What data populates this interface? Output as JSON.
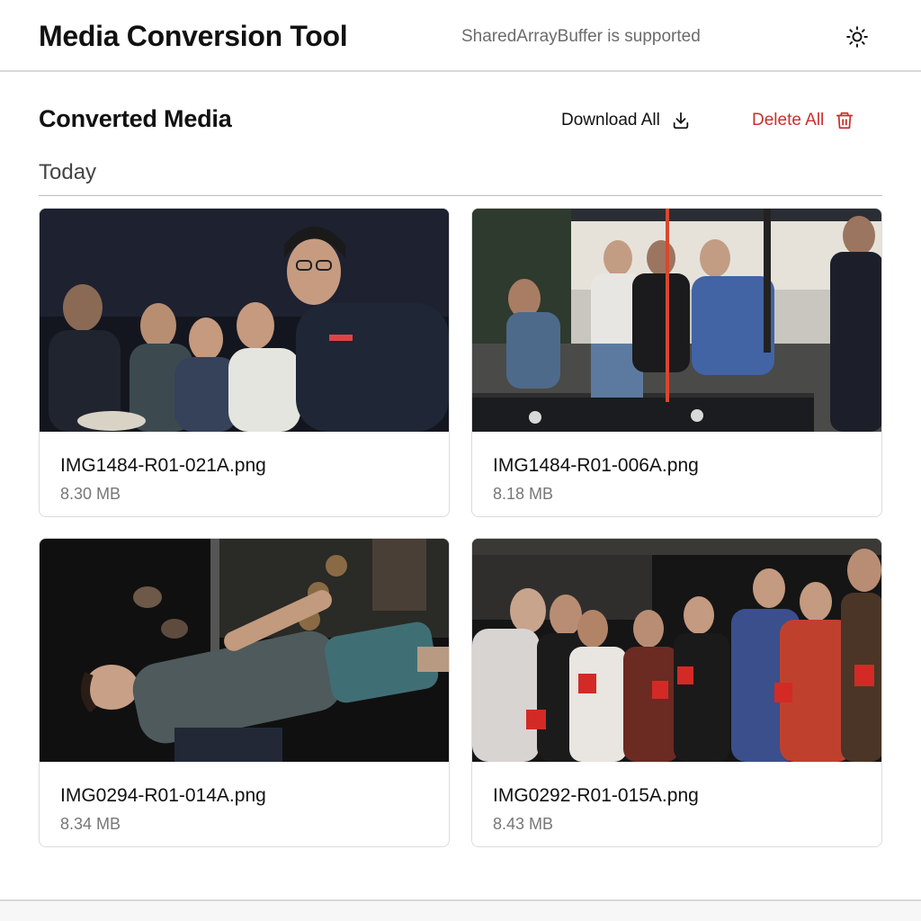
{
  "header": {
    "title": "Media Conversion Tool",
    "status": "SharedArrayBuffer is supported",
    "theme_icon": "sun-icon"
  },
  "section": {
    "title": "Converted Media",
    "download_all_label": "Download All",
    "download_icon": "download-icon",
    "delete_all_label": "Delete All",
    "delete_icon": "trash-icon",
    "delete_color": "#c9302c"
  },
  "groups": [
    {
      "label": "Today",
      "items": [
        {
          "name": "IMG1484-R01-021A.png",
          "size": "8.30 MB"
        },
        {
          "name": "IMG1484-R01-006A.png",
          "size": "8.18 MB"
        },
        {
          "name": "IMG0294-R01-014A.png",
          "size": "8.34 MB"
        },
        {
          "name": "IMG0292-R01-015A.png",
          "size": "8.43 MB"
        }
      ]
    }
  ]
}
